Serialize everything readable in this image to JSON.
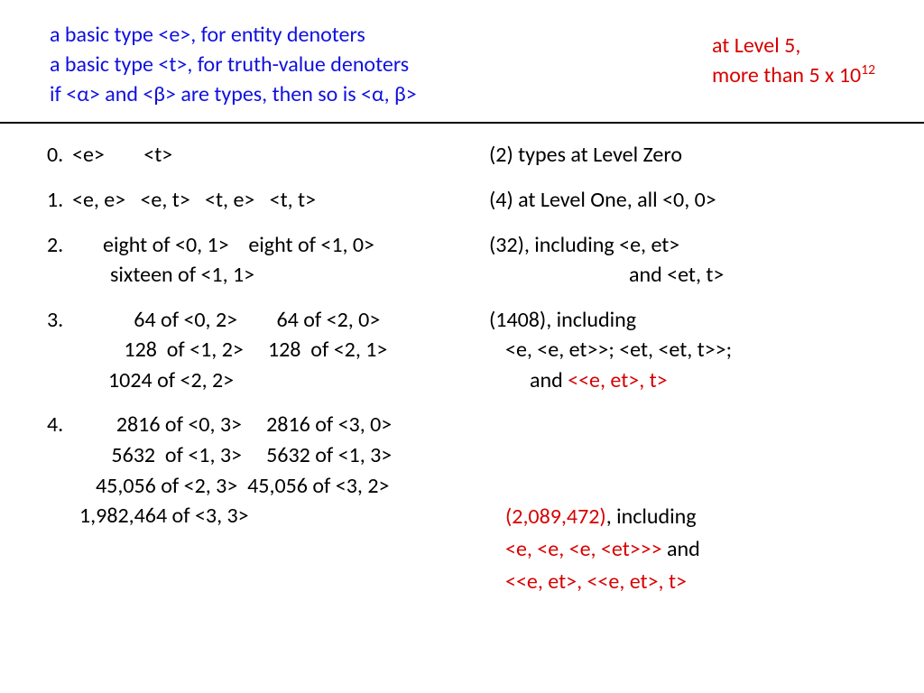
{
  "header": {
    "line1": "a basic type <e>, for entity denoters",
    "line2": "a basic type <t>, for truth-value denoters",
    "line3": "if <α> and <β> are types, then so is <α, β>",
    "right1": "at Level 5,",
    "right2a": "more than 5 x 10",
    "right2exp": "12"
  },
  "rows": {
    "r0": {
      "num": "0.",
      "left": "<e>        <t>",
      "right": "(2) types at Level Zero"
    },
    "r1": {
      "num": "1.",
      "left": "<e, e>   <e, t>   <t, e>   <t, t>",
      "right": "(4) at Level One, all <0, 0>"
    },
    "r2": {
      "num": "2.",
      "l1": "eight of <0, 1>    eight of <1, 0>",
      "l2": "sixteen of <1, 1>",
      "r1": "(32), including <e, et>",
      "r2": "and <et, t>"
    },
    "r3": {
      "num": "3.",
      "l1": "   64 of <0, 2>        64 of <2, 0>",
      "l2": " 128  of <1, 2>     128  of <2, 1>",
      "l3": "1024 of <2, 2>",
      "r1": "(1408), including",
      "r2": "<e, <e, et>>; <et, <et, t>>;",
      "r3a": "and ",
      "r3red": "<<e, et>, t>"
    },
    "r4": {
      "num": "4.",
      "l1": "  2816 of <0, 3>     2816 of <3, 0>",
      "l2": " 5632  of <1, 3>     5632 of <1, 3>",
      "l3": "45,056 of <2, 3>  45,056 of <3, 2>",
      "l4": "1,982,464 of <3, 3>",
      "r1red": "(2,089,472)",
      "r1rest": ", including",
      "r2a": "<e, <e, <e, <et>>> ",
      "r2and": "and",
      "r3red": "<<e, et>, <<e, et>, t>"
    }
  }
}
